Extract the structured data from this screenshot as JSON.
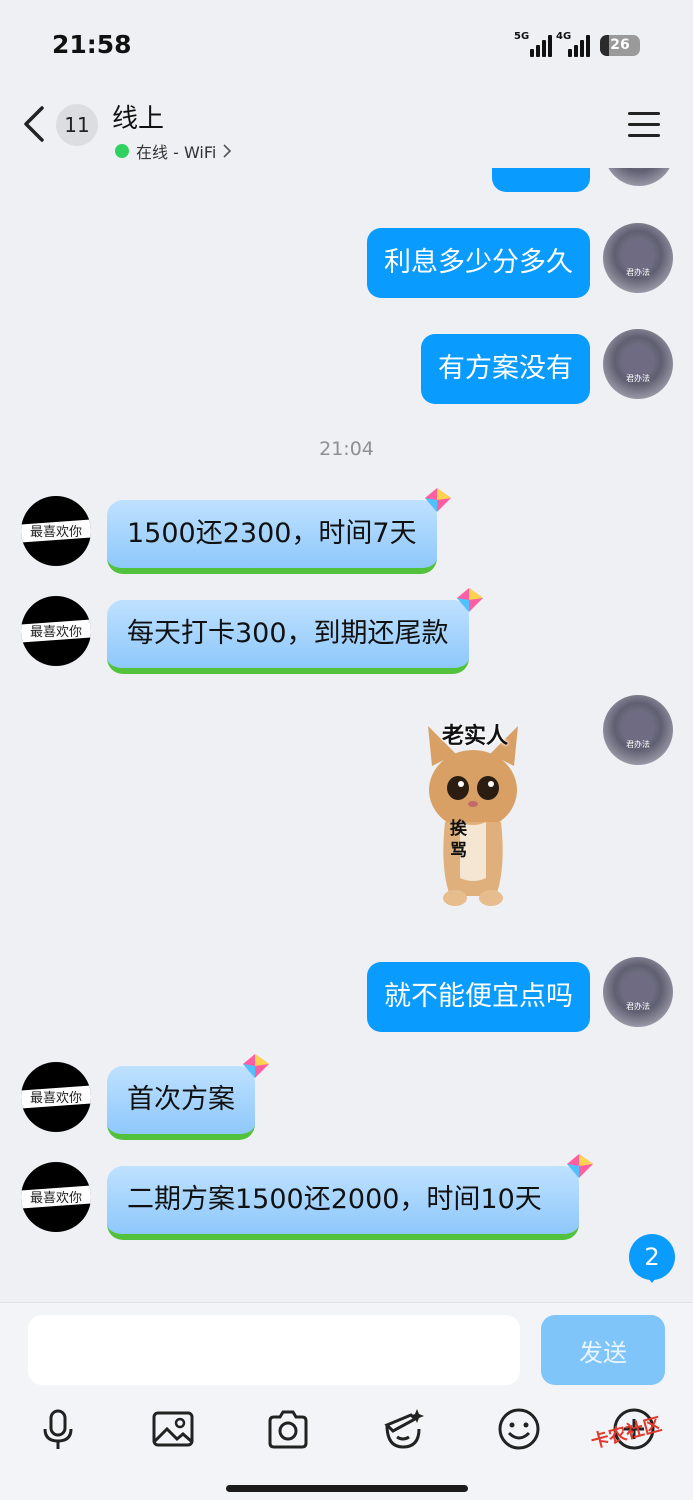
{
  "status_bar": {
    "time": "21:58",
    "signal1": "5G",
    "signal2": "4G",
    "battery": "26"
  },
  "header": {
    "unread_count": "11",
    "title": "线上",
    "status": "在线 - WiFi"
  },
  "messages": {
    "m1": "利息多少分多久",
    "m2": "有方案没有",
    "timestamp": "21:04",
    "m3": "1500还2300，时间7天",
    "m4": "每天打卡300，到期还尾款",
    "sticker_top": "老实人",
    "sticker_mid": "挨骂",
    "m5": "就不能便宜点吗",
    "m6": "首次方案",
    "m7": "二期方案1500还2000，时间10天"
  },
  "avatars": {
    "me_caption": "君办法",
    "other_caption": "最喜欢你"
  },
  "new_message_count": "2",
  "input": {
    "placeholder": "",
    "send_label": "发送"
  },
  "watermark": "卡农社区",
  "colors": {
    "my_bubble": "#0a9bff",
    "other_bubble": "#9fd1fd",
    "online_dot": "#2fd15f"
  },
  "icons": [
    "voice-icon",
    "image-icon",
    "camera-icon",
    "emoji-draw-icon",
    "smile-icon",
    "plus-icon"
  ]
}
